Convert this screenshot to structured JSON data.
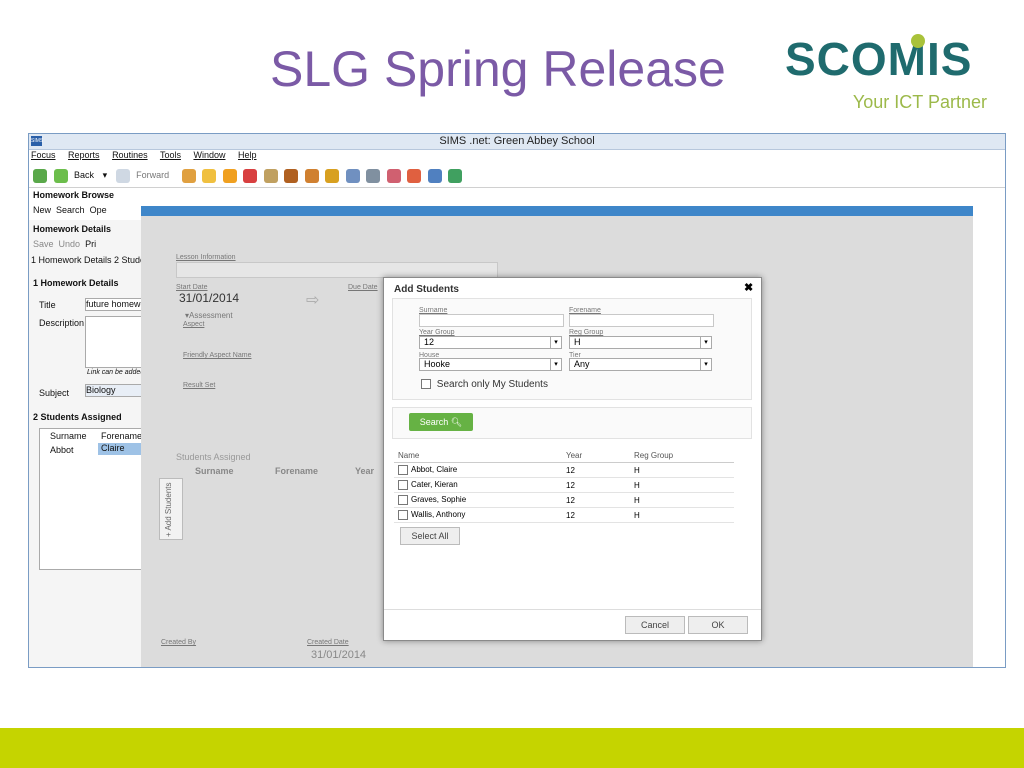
{
  "slide": {
    "title": "SLG Spring Release",
    "logo_word": "SCOMIS",
    "logo_tagline": "Your ICT Partner"
  },
  "window": {
    "title": "SIMS .net: Green Abbey School",
    "menu": [
      "Focus",
      "Reports",
      "Routines",
      "Tools",
      "Window",
      "Help"
    ],
    "toolbar": {
      "back": "Back",
      "forward": "Forward"
    }
  },
  "homework_browse": {
    "title": "Homework Browse",
    "new": "New",
    "search": "Search",
    "open": "Ope"
  },
  "homework_details": {
    "title": "Homework Details",
    "save": "Save",
    "undo": "Undo",
    "print": "Pri",
    "nav": "1 Homework Details  2 Stude",
    "section1": "1 Homework Details",
    "title_label": "Title",
    "title_value": "future homewor",
    "description_label": "Description",
    "link_note": "Link can be added",
    "subject_label": "Subject",
    "subject_value": "Biology",
    "section2": "2 Students Assigned",
    "col_surname": "Surname",
    "col_forename": "Forename",
    "row_surname": "Abbot",
    "row_forename": "Claire"
  },
  "form": {
    "lesson_information": "Lesson Information",
    "start_date_label": "Start Date",
    "start_date": "31/01/2014",
    "due_date_label": "Due Date",
    "assessment": "▾Assessment",
    "aspect": "Aspect",
    "friendly_aspect": "Friendly Aspect Name",
    "result_set": "Result Set",
    "students_assigned": "Students Assigned",
    "col_surname": "Surname",
    "col_forename": "Forename",
    "col_year": "Year",
    "add_students_tab": "+ Add Students",
    "created_by": "Created By",
    "created_date_label": "Created Date",
    "created_date": "31/01/2014"
  },
  "dialog": {
    "title": "Add Students",
    "close": "✖",
    "surname_label": "Surname",
    "forename_label": "Forename",
    "year_group_label": "Year Group",
    "year_group": "12",
    "reg_group_label": "Reg Group",
    "reg_group": "H",
    "house_label": "House",
    "house": "Hooke",
    "tier_label": "Tier",
    "tier": "Any",
    "search_only_mine": "Search only My Students",
    "search_button": "Search",
    "columns": [
      "Name",
      "Year",
      "Reg Group"
    ],
    "rows": [
      {
        "name": "Abbot, Claire",
        "year": "12",
        "reg": "H"
      },
      {
        "name": "Cater, Kieran",
        "year": "12",
        "reg": "H"
      },
      {
        "name": "Graves, Sophie",
        "year": "12",
        "reg": "H"
      },
      {
        "name": "Wallis, Anthony",
        "year": "12",
        "reg": "H"
      }
    ],
    "select_all": "Select All",
    "cancel": "Cancel",
    "ok": "OK"
  },
  "colors": {
    "title": "#7b5aa6",
    "bottom_bar": "#c5d400",
    "search_button": "#66b244"
  }
}
